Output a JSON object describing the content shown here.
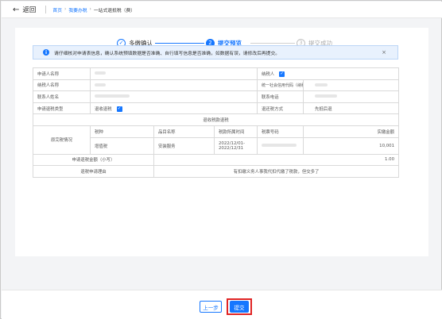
{
  "topbar": {
    "back_label": "返回",
    "breadcrumbs": [
      "首页",
      "我要办税",
      "一站式退抵税（费）"
    ]
  },
  "steps": [
    {
      "num": "✓",
      "label": "多缴确认"
    },
    {
      "num": "2",
      "label": "提交预览"
    },
    {
      "num": "3",
      "label": "提交成功"
    }
  ],
  "alert": {
    "icon": "info-icon",
    "text": "请仔细核对申请表信息，确认系统预填数据是否准确、自行填写信息是否准确，如数据有误，请修改后再提交。",
    "close": "×"
  },
  "table": {
    "applicant_label": "申请人名称",
    "taxpayer_label": "纳税人",
    "taxpayer_name_label": "纳税人名称",
    "credit_code_label": "统一社会信用代码（纳税人识别号）",
    "contact_label": "联系人姓名",
    "phone_label": "联系电话",
    "refund_type_label": "申请退税类型",
    "refund_type_value": "退收退税",
    "refund_method_label": "退还税方式",
    "refund_method_value": "先抵后退",
    "section_title": "退收税款退税",
    "original_label": "原完税情况",
    "col_tax_type": "税种",
    "col_item": "品目名称",
    "col_period": "税款所属时间",
    "col_ticket": "税票号码",
    "col_amount": "实缴金额",
    "row_tax_type": "增值税",
    "row_item": "安装服务",
    "row_period_start": "2022/12/01-",
    "row_period_end": "2022/12/31",
    "row_amount": "10,001",
    "apply_amount_label": "申请退税金额（小写）",
    "apply_amount_value": "1.00",
    "reason_label": "退税申请理由",
    "reason_value": "有扣缴义务人事我代扣代缴了税款，但交多了"
  },
  "footer": {
    "prev_label": "上一步",
    "submit_label": "提交"
  }
}
